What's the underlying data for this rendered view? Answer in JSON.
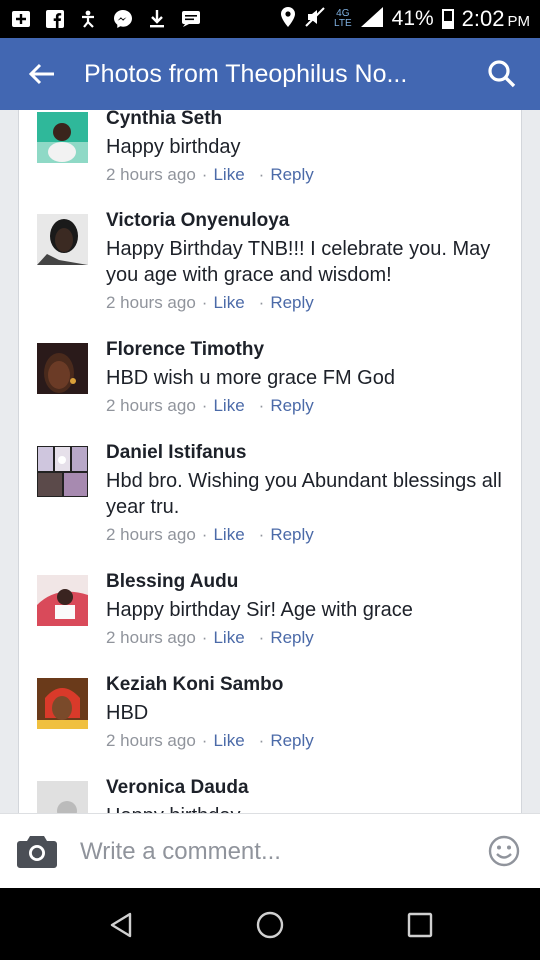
{
  "status_bar": {
    "network_top": "4G",
    "network_lte": "LTE",
    "network_bottom": "LTE",
    "battery_percent": "41%",
    "time": "2:02",
    "ampm": "PM",
    "icons": [
      "add-box-icon",
      "facebook-icon",
      "accessibility-icon",
      "messenger-icon",
      "download-icon",
      "chat-icon",
      "location-icon",
      "mute-icon",
      "signal-icon",
      "battery-icon"
    ]
  },
  "header": {
    "title": "Photos from Theophilus No...",
    "back_icon": "arrow-left-icon",
    "search_icon": "search-icon",
    "background": "#4267b2"
  },
  "comments": [
    {
      "name": "Cynthia Seth",
      "text": "Happy birthday",
      "time": "2 hours ago",
      "like": "Like",
      "reply": "Reply"
    },
    {
      "name": "Victoria Onyenuloya",
      "text": "Happy Birthday TNB!!!  I celebrate you. May you age with grace and wisdom!",
      "time": "2 hours ago",
      "like": "Like",
      "reply": "Reply"
    },
    {
      "name": "Florence Timothy",
      "text": "HBD wish  u more  grace  FM God",
      "time": "2 hours ago",
      "like": "Like",
      "reply": "Reply"
    },
    {
      "name": "Daniel Istifanus",
      "text": "Hbd bro. Wishing you Abundant blessings all year tru.",
      "time": "2 hours ago",
      "like": "Like",
      "reply": "Reply"
    },
    {
      "name": "Blessing Audu",
      "text": "Happy birthday Sir! Age with grace",
      "time": "2 hours ago",
      "like": "Like",
      "reply": "Reply"
    },
    {
      "name": "Keziah Koni Sambo",
      "text": "HBD",
      "time": "2 hours ago",
      "like": "Like",
      "reply": "Reply"
    },
    {
      "name": "Veronica Dauda",
      "text": "Happy birthday",
      "time": "",
      "like": "",
      "reply": ""
    }
  ],
  "composer": {
    "placeholder": "Write a comment...",
    "camera_icon": "camera-icon",
    "smiley_icon": "smiley-icon"
  },
  "navbar": {
    "icons": [
      "back-triangle-icon",
      "home-circle-icon",
      "recents-square-icon"
    ]
  }
}
